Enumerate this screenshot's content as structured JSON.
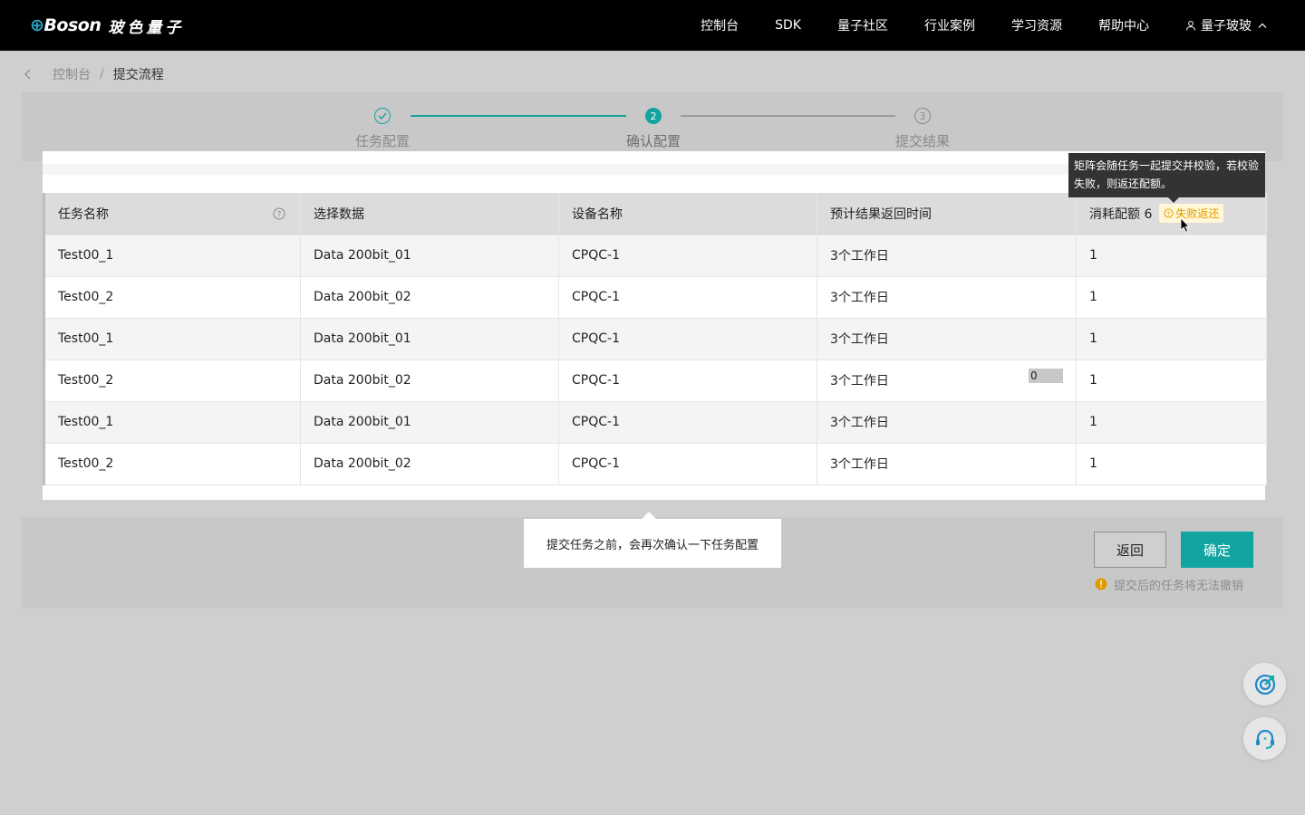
{
  "header": {
    "logo_text": "Boson",
    "logo_cn": "玻色量子",
    "nav": [
      "控制台",
      "SDK",
      "量子社区",
      "行业案例",
      "学习资源",
      "帮助中心"
    ],
    "user": "量子玻玻"
  },
  "breadcrumb": {
    "items": [
      "控制台",
      "提交流程"
    ],
    "separator": "/"
  },
  "steps": [
    {
      "index": "1",
      "label": "任务配置",
      "state": "done"
    },
    {
      "index": "2",
      "label": "确认配置",
      "state": "active"
    },
    {
      "index": "3",
      "label": "提交结果",
      "state": "pending"
    }
  ],
  "table": {
    "headers": [
      "任务名称",
      "选择数据",
      "设备名称",
      "预计结果返回时间",
      "消耗配额 6"
    ],
    "fail_tag": "失败返还",
    "rows": [
      [
        "Test00_1",
        "Data 200bit_01",
        "CPQC-1",
        "3个工作日",
        "1"
      ],
      [
        "Test00_2",
        "Data 200bit_02",
        "CPQC-1",
        "3个工作日",
        "1"
      ],
      [
        "Test00_1",
        "Data 200bit_01",
        "CPQC-1",
        "3个工作日",
        "1"
      ],
      [
        "Test00_2",
        "Data 200bit_02",
        "CPQC-1",
        "3个工作日",
        "1"
      ],
      [
        "Test00_1",
        "Data 200bit_01",
        "CPQC-1",
        "3个工作日",
        "1"
      ],
      [
        "Test00_2",
        "Data 200bit_02",
        "CPQC-1",
        "3个工作日",
        "1"
      ]
    ],
    "mini_input_value": "0"
  },
  "tooltip": "矩阵会随任务一起提交并校验，若校验失败，则返还配额。",
  "hint": "提交任务之前，会再次确认一下任务配置",
  "actions": {
    "back": "返回",
    "confirm": "确定",
    "warning": "提交后的任务将无法撤销"
  },
  "colors": {
    "accent": "#12a4a0",
    "warn": "#e09a00",
    "header_bg": "#000000"
  }
}
